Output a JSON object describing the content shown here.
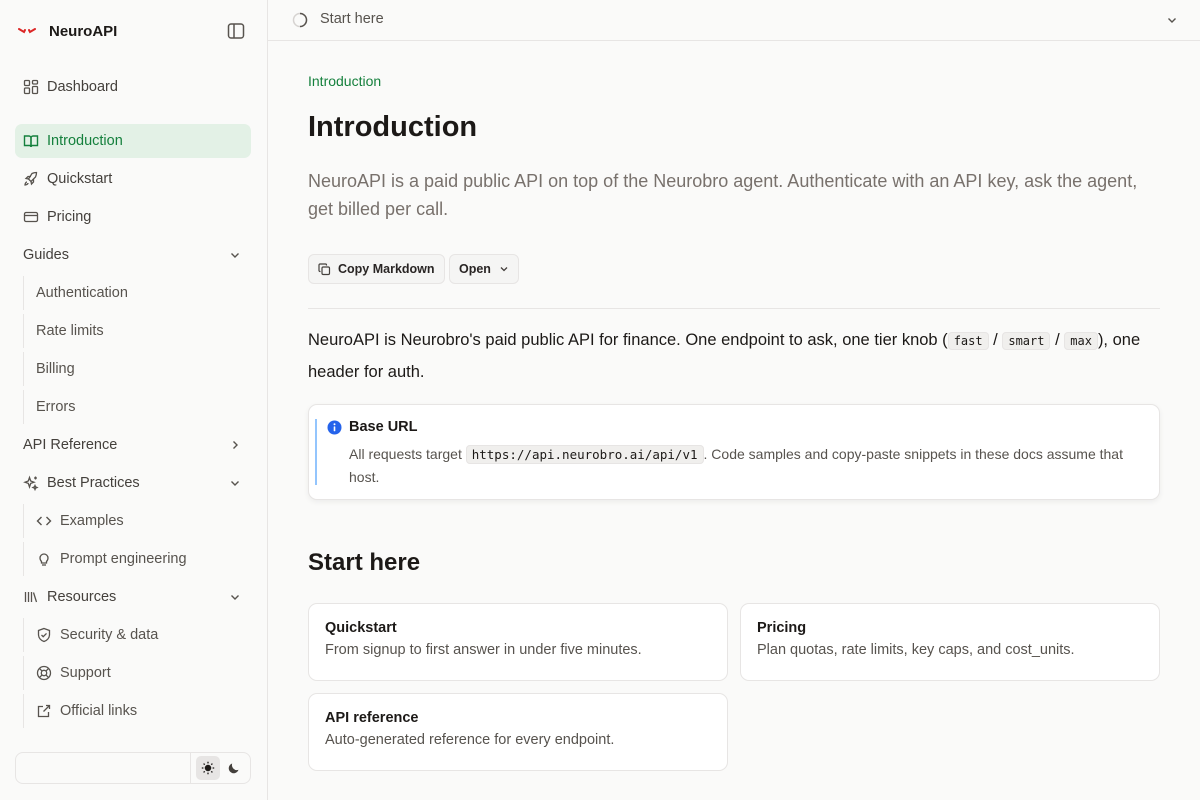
{
  "sidebar": {
    "brand": "NeuroAPI",
    "items": {
      "dashboard": "Dashboard",
      "introduction": "Introduction",
      "quickstart": "Quickstart",
      "pricing": "Pricing",
      "guides": "Guides",
      "authentication": "Authentication",
      "rate_limits": "Rate limits",
      "billing": "Billing",
      "errors": "Errors",
      "api_reference": "API Reference",
      "best_practices": "Best Practices",
      "examples": "Examples",
      "prompt_engineering": "Prompt engineering",
      "resources": "Resources",
      "security_data": "Security & data",
      "support": "Support",
      "official_links": "Official links"
    },
    "theme": {
      "selected": "light"
    }
  },
  "topbar": {
    "breadcrumb": "Start here"
  },
  "page": {
    "eyebrow": "Introduction",
    "title": "Introduction",
    "lead": "NeuroAPI is a paid public API on top of the Neurobro agent. Authenticate with an API key, ask the agent, get billed per call.",
    "copy_markdown": "Copy Markdown",
    "open": "Open",
    "para": {
      "p1": "NeuroAPI is Neurobro's paid public API for finance. One endpoint to ask, one tier knob (",
      "tier_fast": "fast",
      "sep": " / ",
      "tier_smart": "smart",
      "tier_max": "max",
      "p2": "), one header for auth."
    },
    "callout": {
      "title": "Base URL",
      "body_before": "All requests target ",
      "url": "https://api.neurobro.ai/api/v1",
      "body_after": ". Code samples and copy-paste snippets in these docs assume that host."
    },
    "section_title": "Start here",
    "cards": [
      {
        "title": "Quickstart",
        "desc": "From signup to first answer in under five minutes."
      },
      {
        "title": "Pricing",
        "desc": "Plan quotas, rate limits, key caps, and cost_units."
      },
      {
        "title": "API reference",
        "desc": "Auto-generated reference for every endpoint."
      }
    ]
  },
  "colors": {
    "accent": "#15803d",
    "active_bg": "#e3f1e6",
    "brand": "#dc2626",
    "info": "#2563eb"
  }
}
